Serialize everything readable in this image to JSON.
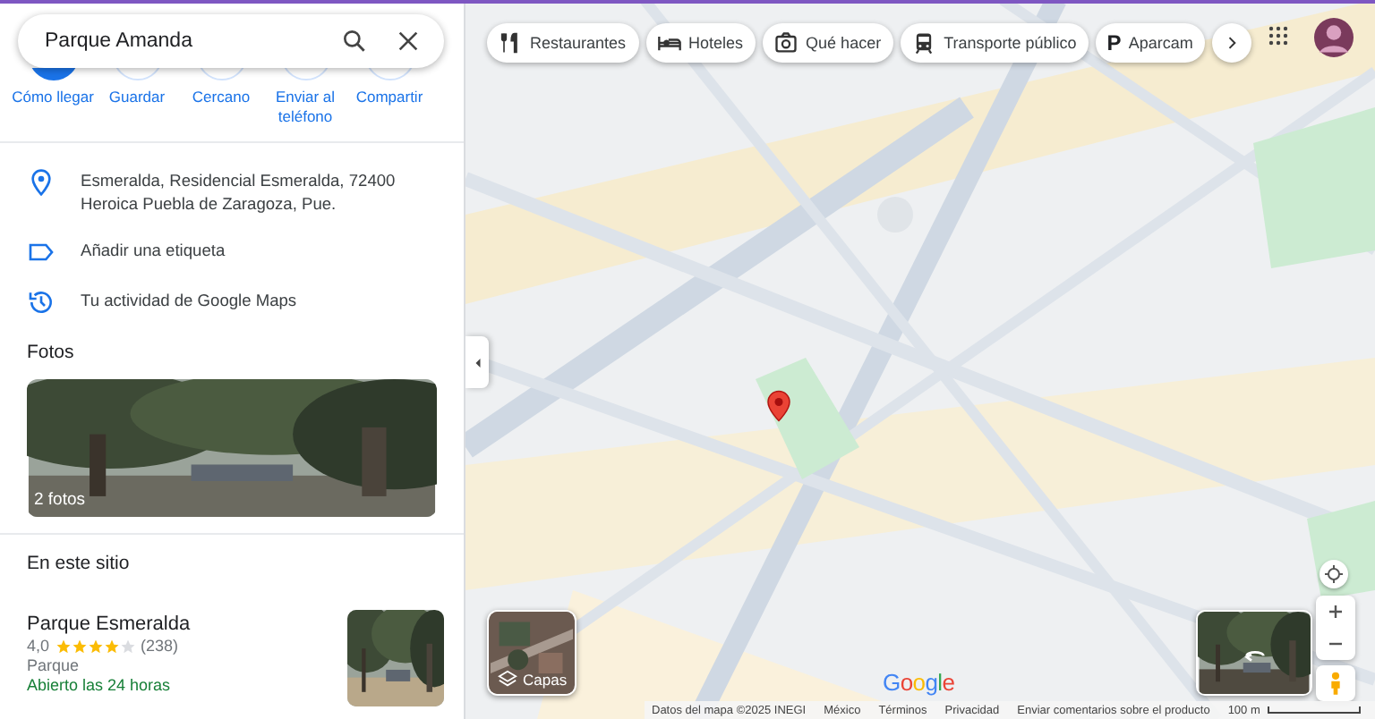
{
  "search": {
    "value": "Parque Amanda"
  },
  "actions": [
    {
      "label": "Cómo llegar",
      "primary": true
    },
    {
      "label": "Guardar",
      "primary": false
    },
    {
      "label": "Cercano",
      "primary": false
    },
    {
      "label": "Enviar al teléfono",
      "primary": false
    },
    {
      "label": "Compartir",
      "primary": false
    }
  ],
  "details": [
    {
      "kind": "address",
      "text": "Esmeralda, Residencial Esmeralda, 72400 Heroica Puebla de Zaragoza, Pue."
    },
    {
      "kind": "label",
      "text": "Añadir una etiqueta"
    },
    {
      "kind": "history",
      "text": "Tu actividad de Google Maps"
    }
  ],
  "photos": {
    "title": "Fotos",
    "count": "2 fotos"
  },
  "nearby": {
    "title": "En este sitio",
    "places": [
      {
        "name": "Parque Esmeralda",
        "rating": "4,0",
        "stars": 4,
        "reviews": "(238)",
        "type": "Parque",
        "hours": "Abierto las 24 horas"
      }
    ]
  },
  "chips": [
    {
      "kind": "restaurants",
      "label": "Restaurantes"
    },
    {
      "kind": "hotels",
      "label": "Hoteles"
    },
    {
      "kind": "things",
      "label": "Qué hacer"
    },
    {
      "kind": "transit",
      "label": "Transporte público"
    },
    {
      "kind": "parking",
      "icon": "P",
      "label": "Aparcam"
    }
  ],
  "layers": {
    "label": "Capas"
  },
  "logo": "Google",
  "footer": [
    "Datos del mapa ©2025 INEGI",
    "México",
    "Términos",
    "Privacidad",
    "Enviar comentarios sobre el producto"
  ],
  "scale": "100 m"
}
